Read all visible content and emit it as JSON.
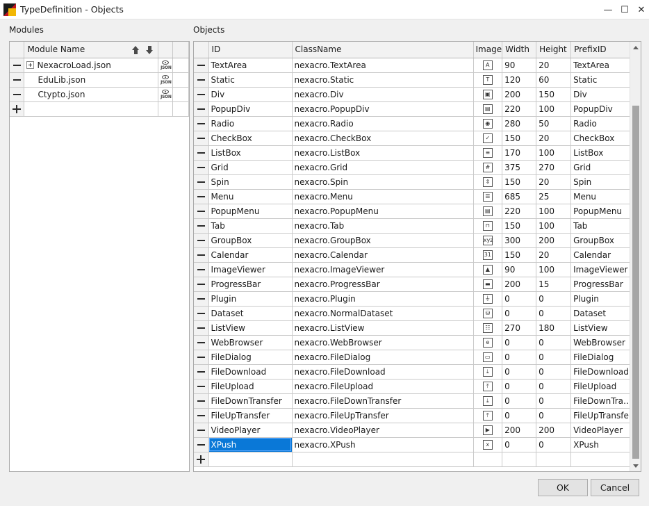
{
  "window": {
    "title": "TypeDefinition - Objects",
    "controls": {
      "minimize": "—",
      "maximize": "☐",
      "close": "✕"
    }
  },
  "modules": {
    "label": "Modules",
    "column_header": "Module Name",
    "rows": [
      {
        "name": "NexacroLoad.json",
        "expandable": true
      },
      {
        "name": "EduLib.json",
        "expandable": false
      },
      {
        "name": "Ctypto.json",
        "expandable": false
      }
    ]
  },
  "objects": {
    "label": "Objects",
    "columns": {
      "id": "ID",
      "classname": "ClassName",
      "image": "Image",
      "width": "Width",
      "height": "Height",
      "prefix": "PrefixID"
    },
    "selected_id": "XPush",
    "rows": [
      {
        "id": "TextArea",
        "classname": "nexacro.TextArea",
        "icon": "textarea-icon",
        "glyph": "A",
        "width": "90",
        "height": "20",
        "prefix": "TextArea"
      },
      {
        "id": "Static",
        "classname": "nexacro.Static",
        "icon": "static-icon",
        "glyph": "T",
        "width": "120",
        "height": "60",
        "prefix": "Static"
      },
      {
        "id": "Div",
        "classname": "nexacro.Div",
        "icon": "div-icon",
        "glyph": "▣",
        "width": "200",
        "height": "150",
        "prefix": "Div"
      },
      {
        "id": "PopupDiv",
        "classname": "nexacro.PopupDiv",
        "icon": "popupdiv-icon",
        "glyph": "▤",
        "width": "220",
        "height": "100",
        "prefix": "PopupDiv"
      },
      {
        "id": "Radio",
        "classname": "nexacro.Radio",
        "icon": "radio-icon",
        "glyph": "◉",
        "width": "280",
        "height": "50",
        "prefix": "Radio"
      },
      {
        "id": "CheckBox",
        "classname": "nexacro.CheckBox",
        "icon": "checkbox-icon",
        "glyph": "✓",
        "width": "150",
        "height": "20",
        "prefix": "CheckBox"
      },
      {
        "id": "ListBox",
        "classname": "nexacro.ListBox",
        "icon": "listbox-icon",
        "glyph": "≡",
        "width": "170",
        "height": "100",
        "prefix": "ListBox"
      },
      {
        "id": "Grid",
        "classname": "nexacro.Grid",
        "icon": "grid-icon",
        "glyph": "#",
        "width": "375",
        "height": "270",
        "prefix": "Grid"
      },
      {
        "id": "Spin",
        "classname": "nexacro.Spin",
        "icon": "spin-icon",
        "glyph": "⇕",
        "width": "150",
        "height": "20",
        "prefix": "Spin"
      },
      {
        "id": "Menu",
        "classname": "nexacro.Menu",
        "icon": "menu-icon",
        "glyph": "☰",
        "width": "685",
        "height": "25",
        "prefix": "Menu"
      },
      {
        "id": "PopupMenu",
        "classname": "nexacro.PopupMenu",
        "icon": "popupmenu-icon",
        "glyph": "▤",
        "width": "220",
        "height": "100",
        "prefix": "PopupMenu"
      },
      {
        "id": "Tab",
        "classname": "nexacro.Tab",
        "icon": "tab-icon",
        "glyph": "⊓",
        "width": "150",
        "height": "100",
        "prefix": "Tab"
      },
      {
        "id": "GroupBox",
        "classname": "nexacro.GroupBox",
        "icon": "groupbox-icon",
        "glyph": "xyz",
        "width": "300",
        "height": "200",
        "prefix": "GroupBox"
      },
      {
        "id": "Calendar",
        "classname": "nexacro.Calendar",
        "icon": "calendar-icon",
        "glyph": "31",
        "width": "150",
        "height": "20",
        "prefix": "Calendar"
      },
      {
        "id": "ImageViewer",
        "classname": "nexacro.ImageViewer",
        "icon": "imageviewer-icon",
        "glyph": "▲",
        "width": "90",
        "height": "100",
        "prefix": "ImageViewer"
      },
      {
        "id": "ProgressBar",
        "classname": "nexacro.ProgressBar",
        "icon": "progressbar-icon",
        "glyph": "▬",
        "width": "200",
        "height": "15",
        "prefix": "ProgressBar"
      },
      {
        "id": "Plugin",
        "classname": "nexacro.Plugin",
        "icon": "plugin-icon",
        "glyph": "⏚",
        "width": "0",
        "height": "0",
        "prefix": "Plugin"
      },
      {
        "id": "Dataset",
        "classname": "nexacro.NormalDataset",
        "icon": "dataset-icon",
        "glyph": "⛁",
        "width": "0",
        "height": "0",
        "prefix": "Dataset"
      },
      {
        "id": "ListView",
        "classname": "nexacro.ListView",
        "icon": "listview-icon",
        "glyph": "☷",
        "width": "270",
        "height": "180",
        "prefix": "ListView"
      },
      {
        "id": "WebBrowser",
        "classname": "nexacro.WebBrowser",
        "icon": "webbrowser-icon",
        "glyph": "e",
        "width": "0",
        "height": "0",
        "prefix": "WebBrowser"
      },
      {
        "id": "FileDialog",
        "classname": "nexacro.FileDialog",
        "icon": "filedialog-icon",
        "glyph": "▭",
        "width": "0",
        "height": "0",
        "prefix": "FileDialog"
      },
      {
        "id": "FileDownload",
        "classname": "nexacro.FileDownload",
        "icon": "filedownload-icon",
        "glyph": "⤓",
        "width": "0",
        "height": "0",
        "prefix": "FileDownload"
      },
      {
        "id": "FileUpload",
        "classname": "nexacro.FileUpload",
        "icon": "fileupload-icon",
        "glyph": "⤒",
        "width": "0",
        "height": "0",
        "prefix": "FileUpload"
      },
      {
        "id": "FileDownTransfer",
        "classname": "nexacro.FileDownTransfer",
        "icon": "filedowntransfer-icon",
        "glyph": "⤓",
        "width": "0",
        "height": "0",
        "prefix": "FileDownTra…"
      },
      {
        "id": "FileUpTransfer",
        "classname": "nexacro.FileUpTransfer",
        "icon": "fileuptransfer-icon",
        "glyph": "⤒",
        "width": "0",
        "height": "0",
        "prefix": "FileUpTransfer"
      },
      {
        "id": "VideoPlayer",
        "classname": "nexacro.VideoPlayer",
        "icon": "videoplayer-icon",
        "glyph": "▶",
        "width": "200",
        "height": "200",
        "prefix": "VideoPlayer"
      },
      {
        "id": "XPush",
        "classname": "nexacro.XPush",
        "icon": "xpush-icon",
        "glyph": "x",
        "width": "0",
        "height": "0",
        "prefix": "XPush"
      }
    ]
  },
  "buttons": {
    "ok": "OK",
    "cancel": "Cancel"
  },
  "colors": {
    "selection": "#0a78d7",
    "panel_border": "#a9a9a9",
    "dialog_bg": "#f0f0f0"
  }
}
